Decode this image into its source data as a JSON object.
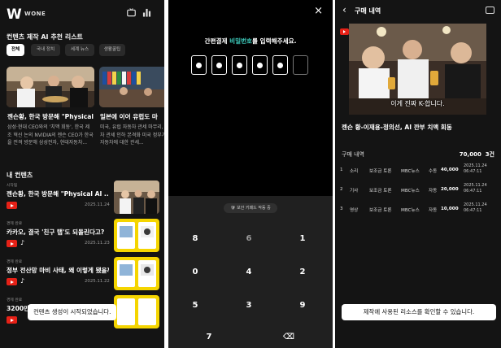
{
  "panel1": {
    "header": {
      "logo_mark": "W",
      "logo_text": "WONE"
    },
    "recommend_title": "컨텐츠 제작 AI 추천 리스트",
    "chips": [
      {
        "label": "전체",
        "active": true
      },
      {
        "label": "국내 정치",
        "active": false
      },
      {
        "label": "세계 뉴스",
        "active": false
      },
      {
        "label": "생활꿀팁",
        "active": false
      }
    ],
    "cards": [
      {
        "title": "젠슨황, 한국 방문해 \"Physical",
        "desc": "삼성·현대 CEO와의 '치맥 회동', 한국 제조 혁신 논의 NVIDIA의 젠슨 CEO가 한국을 전격 방문해 삼성전자, 현대자동차..."
      },
      {
        "title": "일본에 이어 유럽도 마",
        "desc": "미국, 유럽 자동차 관세 마무리, 유럽 자동차 관세 인하 본격화 미국 정부가 유럽산 자동차에 대한 관세..."
      }
    ],
    "my_contents_title": "내 컨텐츠",
    "rows": [
      {
        "category": "시작됨",
        "title": "젠슨황, 한국 방문해 \"Physical AI ...",
        "platform": "youtube",
        "date": "2025.11.24"
      },
      {
        "category": "경제 완료",
        "title": "카카오, 결국 '친구 탭'도 되돌린다고?",
        "platform": "tiktok",
        "date": "2025.11.23"
      },
      {
        "category": "경제 완료",
        "title": "정부 전산망 마비 사태, 왜 이렇게 됐을까?",
        "platform": "tiktok",
        "date": "2025.11.22"
      },
      {
        "category": "경제 완료",
        "title": "3200만",
        "platform": "youtube",
        "date": ""
      }
    ],
    "toast": "컨텐츠 생성이 시작되었습니다."
  },
  "panel2": {
    "close_icon": "×",
    "prompt_before": "간편결제 ",
    "prompt_highlight": "비밀번호",
    "prompt_after": "를 입력해주세요.",
    "pin_filled": 5,
    "pin_total": 6,
    "secure_badge": "보안 키패드 작동 중",
    "keys": [
      [
        "8",
        "6",
        "1"
      ],
      [
        "0",
        "4",
        "2"
      ],
      [
        "5",
        "3",
        "9"
      ],
      [
        "",
        "7",
        "⌫"
      ]
    ],
    "accent": "#3fd0c0"
  },
  "panel3": {
    "title": "구매 내역",
    "video_caption": "이게 진짜 K-합니다.",
    "video_title": "젠슨 황-이재용-정의선, AI 깐부 치맥 회동",
    "summary_label": "구매 내역",
    "summary_amount": "70,000",
    "summary_count": "3건",
    "rows": [
      {
        "no": "1",
        "type": "소리",
        "name": "보조금 토론",
        "source": "MBC뉴스",
        "mode": "수동",
        "price": "40,000",
        "date": "2025.11.24",
        "time": "06:47:11"
      },
      {
        "no": "2",
        "type": "기사",
        "name": "보조금 토론",
        "source": "MBC뉴스",
        "mode": "자동",
        "price": "20,000",
        "date": "2025.11.24",
        "time": "06:47:11"
      },
      {
        "no": "3",
        "type": "영상",
        "name": "보조금 토론",
        "source": "MBC뉴스",
        "mode": "자동",
        "price": "10,000",
        "date": "2025.11.24",
        "time": "06:47:11"
      }
    ],
    "toast": "제작에 사용된 리소스를 확인할 수 있습니다."
  }
}
